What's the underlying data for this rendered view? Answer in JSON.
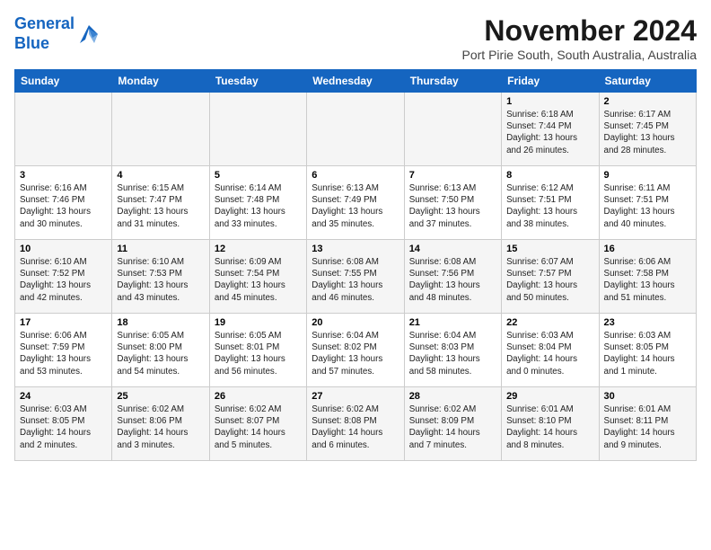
{
  "header": {
    "logo_line1": "General",
    "logo_line2": "Blue",
    "month": "November 2024",
    "subtitle": "Port Pirie South, South Australia, Australia"
  },
  "weekdays": [
    "Sunday",
    "Monday",
    "Tuesday",
    "Wednesday",
    "Thursday",
    "Friday",
    "Saturday"
  ],
  "weeks": [
    [
      {
        "day": "",
        "text": ""
      },
      {
        "day": "",
        "text": ""
      },
      {
        "day": "",
        "text": ""
      },
      {
        "day": "",
        "text": ""
      },
      {
        "day": "",
        "text": ""
      },
      {
        "day": "1",
        "text": "Sunrise: 6:18 AM\nSunset: 7:44 PM\nDaylight: 13 hours\nand 26 minutes."
      },
      {
        "day": "2",
        "text": "Sunrise: 6:17 AM\nSunset: 7:45 PM\nDaylight: 13 hours\nand 28 minutes."
      }
    ],
    [
      {
        "day": "3",
        "text": "Sunrise: 6:16 AM\nSunset: 7:46 PM\nDaylight: 13 hours\nand 30 minutes."
      },
      {
        "day": "4",
        "text": "Sunrise: 6:15 AM\nSunset: 7:47 PM\nDaylight: 13 hours\nand 31 minutes."
      },
      {
        "day": "5",
        "text": "Sunrise: 6:14 AM\nSunset: 7:48 PM\nDaylight: 13 hours\nand 33 minutes."
      },
      {
        "day": "6",
        "text": "Sunrise: 6:13 AM\nSunset: 7:49 PM\nDaylight: 13 hours\nand 35 minutes."
      },
      {
        "day": "7",
        "text": "Sunrise: 6:13 AM\nSunset: 7:50 PM\nDaylight: 13 hours\nand 37 minutes."
      },
      {
        "day": "8",
        "text": "Sunrise: 6:12 AM\nSunset: 7:51 PM\nDaylight: 13 hours\nand 38 minutes."
      },
      {
        "day": "9",
        "text": "Sunrise: 6:11 AM\nSunset: 7:51 PM\nDaylight: 13 hours\nand 40 minutes."
      }
    ],
    [
      {
        "day": "10",
        "text": "Sunrise: 6:10 AM\nSunset: 7:52 PM\nDaylight: 13 hours\nand 42 minutes."
      },
      {
        "day": "11",
        "text": "Sunrise: 6:10 AM\nSunset: 7:53 PM\nDaylight: 13 hours\nand 43 minutes."
      },
      {
        "day": "12",
        "text": "Sunrise: 6:09 AM\nSunset: 7:54 PM\nDaylight: 13 hours\nand 45 minutes."
      },
      {
        "day": "13",
        "text": "Sunrise: 6:08 AM\nSunset: 7:55 PM\nDaylight: 13 hours\nand 46 minutes."
      },
      {
        "day": "14",
        "text": "Sunrise: 6:08 AM\nSunset: 7:56 PM\nDaylight: 13 hours\nand 48 minutes."
      },
      {
        "day": "15",
        "text": "Sunrise: 6:07 AM\nSunset: 7:57 PM\nDaylight: 13 hours\nand 50 minutes."
      },
      {
        "day": "16",
        "text": "Sunrise: 6:06 AM\nSunset: 7:58 PM\nDaylight: 13 hours\nand 51 minutes."
      }
    ],
    [
      {
        "day": "17",
        "text": "Sunrise: 6:06 AM\nSunset: 7:59 PM\nDaylight: 13 hours\nand 53 minutes."
      },
      {
        "day": "18",
        "text": "Sunrise: 6:05 AM\nSunset: 8:00 PM\nDaylight: 13 hours\nand 54 minutes."
      },
      {
        "day": "19",
        "text": "Sunrise: 6:05 AM\nSunset: 8:01 PM\nDaylight: 13 hours\nand 56 minutes."
      },
      {
        "day": "20",
        "text": "Sunrise: 6:04 AM\nSunset: 8:02 PM\nDaylight: 13 hours\nand 57 minutes."
      },
      {
        "day": "21",
        "text": "Sunrise: 6:04 AM\nSunset: 8:03 PM\nDaylight: 13 hours\nand 58 minutes."
      },
      {
        "day": "22",
        "text": "Sunrise: 6:03 AM\nSunset: 8:04 PM\nDaylight: 14 hours\nand 0 minutes."
      },
      {
        "day": "23",
        "text": "Sunrise: 6:03 AM\nSunset: 8:05 PM\nDaylight: 14 hours\nand 1 minute."
      }
    ],
    [
      {
        "day": "24",
        "text": "Sunrise: 6:03 AM\nSunset: 8:05 PM\nDaylight: 14 hours\nand 2 minutes."
      },
      {
        "day": "25",
        "text": "Sunrise: 6:02 AM\nSunset: 8:06 PM\nDaylight: 14 hours\nand 3 minutes."
      },
      {
        "day": "26",
        "text": "Sunrise: 6:02 AM\nSunset: 8:07 PM\nDaylight: 14 hours\nand 5 minutes."
      },
      {
        "day": "27",
        "text": "Sunrise: 6:02 AM\nSunset: 8:08 PM\nDaylight: 14 hours\nand 6 minutes."
      },
      {
        "day": "28",
        "text": "Sunrise: 6:02 AM\nSunset: 8:09 PM\nDaylight: 14 hours\nand 7 minutes."
      },
      {
        "day": "29",
        "text": "Sunrise: 6:01 AM\nSunset: 8:10 PM\nDaylight: 14 hours\nand 8 minutes."
      },
      {
        "day": "30",
        "text": "Sunrise: 6:01 AM\nSunset: 8:11 PM\nDaylight: 14 hours\nand 9 minutes."
      }
    ]
  ]
}
